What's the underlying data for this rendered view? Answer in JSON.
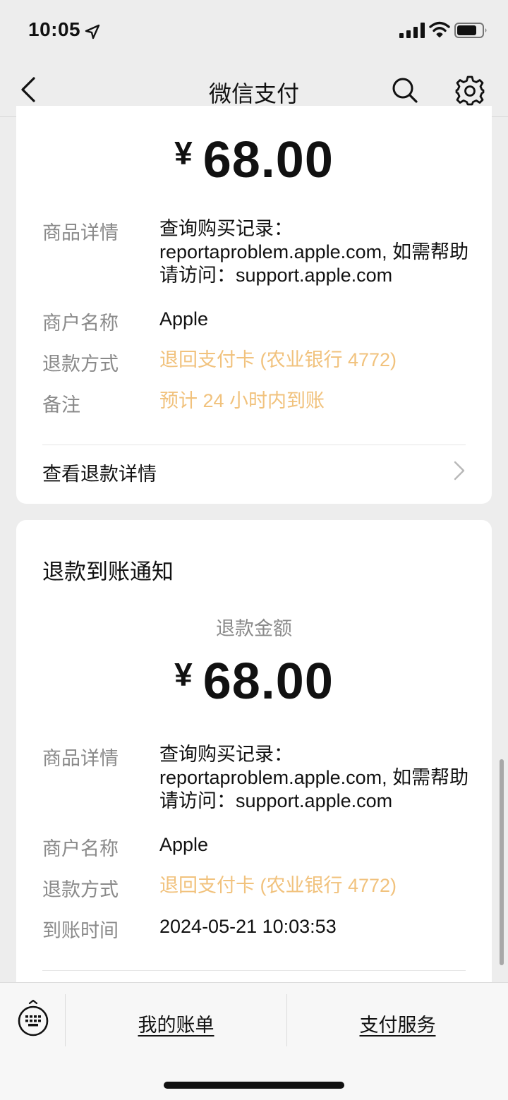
{
  "status_bar": {
    "time": "10:05"
  },
  "nav": {
    "title": "微信支付"
  },
  "card1": {
    "currency": "¥",
    "amount": "68.00",
    "rows": [
      {
        "label": "商品详情",
        "value": "查询购买记录：reportaproblem.apple.com, 如需帮助请访问：support.apple.com"
      },
      {
        "label": "商户名称",
        "value": "Apple"
      },
      {
        "label": "退款方式",
        "value": "退回支付卡 (农业银行 4772)"
      },
      {
        "label": "备注",
        "value": "预计 24 小时内到账"
      }
    ],
    "link": "查看退款详情"
  },
  "card2": {
    "title": "退款到账通知",
    "caption": "退款金额",
    "currency": "¥",
    "amount": "68.00",
    "rows": [
      {
        "label": "商品详情",
        "value": "查询购买记录：reportaproblem.apple.com, 如需帮助请访问：support.apple.com"
      },
      {
        "label": "商户名称",
        "value": "Apple"
      },
      {
        "label": "退款方式",
        "value": "退回支付卡 (农业银行 4772)"
      },
      {
        "label": "到账时间",
        "value": "2024-05-21 10:03:53"
      }
    ]
  },
  "toolbar": {
    "my_bill": "我的账单",
    "pay_service": "支付服务"
  },
  "colors": {
    "accent_orange": "#f1c27d",
    "background": "#ededed",
    "label_gray": "#8a8a8a"
  },
  "icons": [
    "location-arrow-icon",
    "signal-icon",
    "wifi-icon",
    "battery-icon",
    "back-arrow-icon",
    "search-icon",
    "gear-icon",
    "chevron-right-icon",
    "keyboard-icon"
  ]
}
